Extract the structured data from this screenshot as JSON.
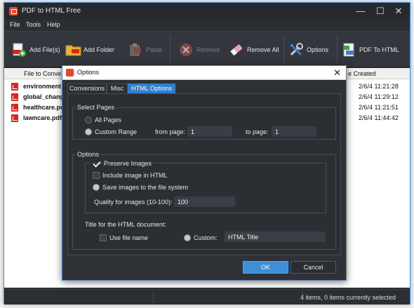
{
  "app": {
    "title": "PDF to HTML Free"
  },
  "window_controls": {
    "minimize": "—",
    "maximize": "☐",
    "close": "✕"
  },
  "menu": [
    "File",
    "Tools",
    "Help"
  ],
  "toolbar": {
    "add_files": "Add File(s)",
    "add_folder": "Add Folder",
    "paste": "Paste",
    "remove": "Remove",
    "remove_all": "Remove All",
    "options": "Options",
    "pdf_to_html": "PDF To HTML"
  },
  "grid": {
    "col_file": "File to Conve",
    "col_created": "e Created",
    "rows": [
      {
        "name": "environment.",
        "date": "2/6/4 11:21:28"
      },
      {
        "name": "global_chang",
        "date": "2/6/4 11:29:12"
      },
      {
        "name": "healthcare.pc",
        "date": "2/6/4 11:21:51"
      },
      {
        "name": "lawncare.pdf",
        "date": "2/6/4 11:44:42"
      }
    ]
  },
  "status": {
    "text": "4 items, 0 items currently selected"
  },
  "dialog": {
    "title": "Options",
    "close": "✕",
    "tabs": [
      "Conversions",
      "Misc",
      "HTML Options"
    ],
    "select_pages": {
      "title": "Select Pages",
      "all_pages": "All Pages",
      "custom_range": "Custom Range",
      "from_label": "from page:",
      "from_value": "1",
      "to_label": "to page:",
      "to_value": "1"
    },
    "options": {
      "title": "Options",
      "preserve_images": "Preserve Images",
      "include_image": "Include image in HTML",
      "save_images": "Save images to the file system",
      "quality_label": "Quality for images (10-100):",
      "quality_value": "100",
      "title_doc_label": "Title for the HTML document:",
      "use_file_name": "Use file name",
      "custom_label": "Custom:",
      "custom_value": "HTML Title"
    },
    "ok": "OK",
    "cancel": "Cancel"
  }
}
